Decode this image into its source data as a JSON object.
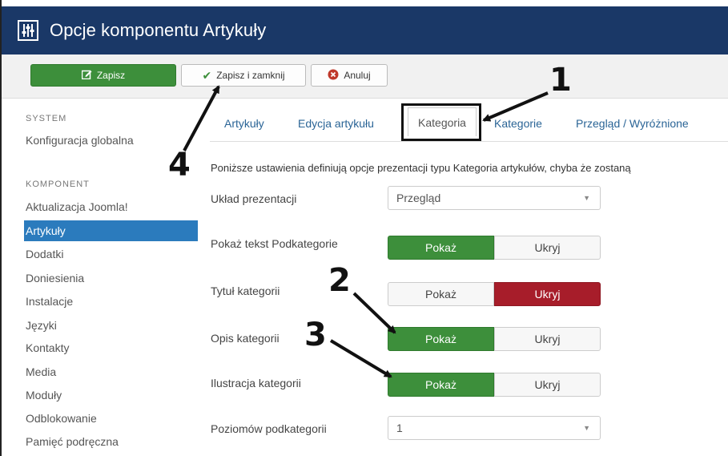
{
  "window": {
    "title": "Opcje komponentu Artykuły"
  },
  "toolbar": {
    "save_label": "Zapisz",
    "save_close_label": "Zapisz i zamknij",
    "cancel_label": "Anuluj"
  },
  "sidebar": {
    "sections": [
      {
        "heading": "SYSTEM",
        "items": [
          "Konfiguracja globalna"
        ]
      },
      {
        "heading": "KOMPONENT",
        "items": [
          "Aktualizacja Joomla!",
          "Artykuły",
          "Dodatki",
          "Doniesienia",
          "Instalacje",
          "Języki",
          "Kontakty",
          "Media",
          "Moduły",
          "Odblokowanie",
          "Pamięć podręczna"
        ]
      }
    ],
    "active_item": "Artykuły"
  },
  "tabs": [
    "Artykuły",
    "Edycja artykułu",
    "Kategoria",
    "Kategorie",
    "Przegląd / Wyróżnione"
  ],
  "active_tab": "Kategoria",
  "description": "Poniższe ustawienia definiują opcje prezentacji typu Kategoria artykułów, chyba że zostaną",
  "fields": {
    "layout": {
      "label": "Układ prezentacji",
      "value": "Przegląd"
    },
    "show_subcat_text": {
      "label": "Pokaż tekst Podkategorie",
      "options": [
        "Pokaż",
        "Ukryj"
      ],
      "selected": "Pokaż"
    },
    "category_title": {
      "label": "Tytuł kategorii",
      "options": [
        "Pokaż",
        "Ukryj"
      ],
      "selected": "Ukryj"
    },
    "category_desc": {
      "label": "Opis kategorii",
      "options": [
        "Pokaż",
        "Ukryj"
      ],
      "selected": "Pokaż"
    },
    "category_image": {
      "label": "Ilustracja kategorii",
      "options": [
        "Pokaż",
        "Ukryj"
      ],
      "selected": "Pokaż"
    },
    "subcat_levels": {
      "label": "Poziomów podkategorii",
      "value": "1"
    }
  },
  "annotations": [
    "1",
    "2",
    "3",
    "4"
  ],
  "colors": {
    "titlebar": "#1a3867",
    "save": "#3d8f3b",
    "active_side": "#2b7bbd",
    "show_on": "#3d8f3b",
    "hide_on": "#a71d2a",
    "link": "#2a6496"
  }
}
